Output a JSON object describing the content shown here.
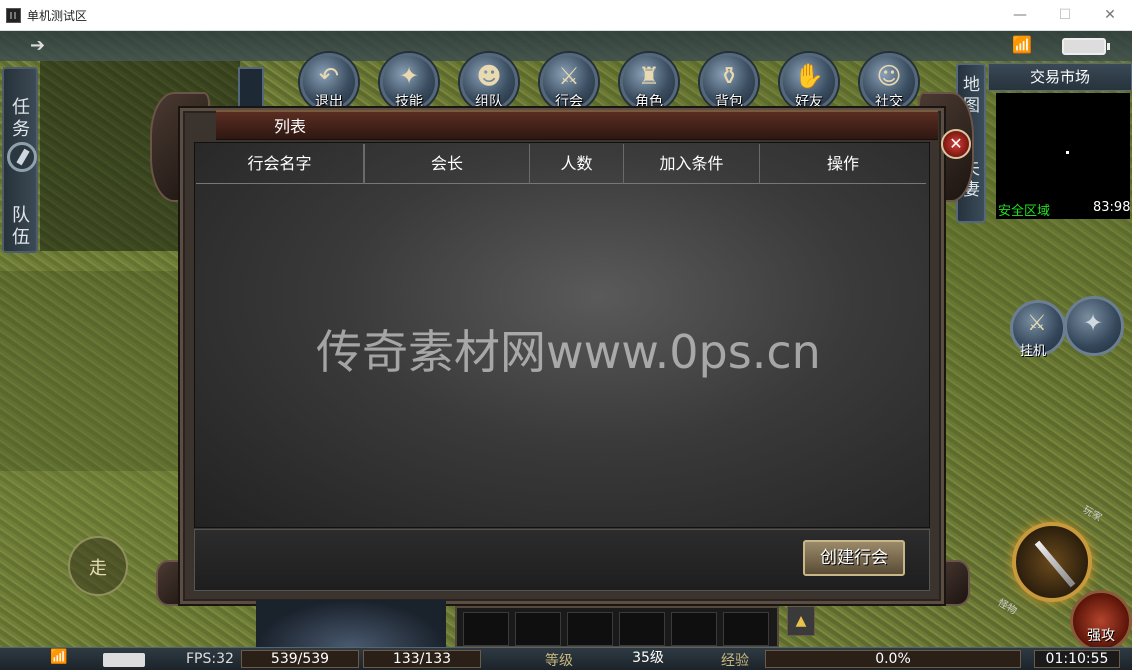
{
  "window": {
    "title": "单机测试区",
    "minimize": "—",
    "maximize": "☐",
    "close": "✕"
  },
  "left_tabs": {
    "task": "任务",
    "team": "队伍"
  },
  "menu": [
    {
      "key": "exit",
      "label": "退出",
      "glyph": "↶"
    },
    {
      "key": "skill",
      "label": "技能",
      "glyph": "✦"
    },
    {
      "key": "group",
      "label": "组队",
      "glyph": "☻"
    },
    {
      "key": "guild",
      "label": "行会",
      "glyph": "⚔"
    },
    {
      "key": "character",
      "label": "角色",
      "glyph": "♜"
    },
    {
      "key": "bag",
      "label": "背包",
      "glyph": "⚱"
    },
    {
      "key": "friends",
      "label": "好友",
      "glyph": "✋"
    },
    {
      "key": "social",
      "label": "社交",
      "glyph": "☺"
    }
  ],
  "map": {
    "side_tabs": {
      "map": "地图",
      "couple": "夫妻"
    },
    "title": "交易市场",
    "zone": "安全区域",
    "coords": "83:98"
  },
  "dialog": {
    "title": "列表",
    "columns": [
      "行会名字",
      "会长",
      "人数",
      "加入条件",
      "操作"
    ],
    "watermark": "传奇素材网www.0ps.cn",
    "create_button": "创建行会",
    "close": "✕"
  },
  "controls": {
    "hangup": "挂机",
    "walk": "走",
    "strong_attack": "强攻",
    "arc_top": "玩家",
    "arc_bottom": "怪物"
  },
  "hud": {
    "fps": "FPS:32",
    "hp": "539/539",
    "mp": "133/133",
    "level_label": "等级",
    "level": "35级",
    "exp_label": "经验",
    "exp": "0.0%",
    "time": "01:10:55"
  },
  "colors": {
    "safe_zone": "#1fe01f",
    "dialog_header": "#5a2d22",
    "accent_gold": "#c9b688"
  }
}
